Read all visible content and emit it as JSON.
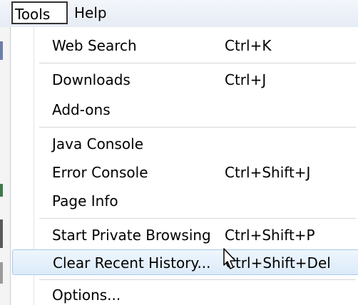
{
  "menubar": {
    "tools_label": "Tools",
    "help_label": "Help"
  },
  "menu": {
    "web_search": {
      "label": "Web Search",
      "shortcut": "Ctrl+K"
    },
    "downloads": {
      "label": "Downloads",
      "shortcut": "Ctrl+J"
    },
    "addons": {
      "label": "Add-ons"
    },
    "java_console": {
      "label": "Java Console"
    },
    "error_console": {
      "label": "Error Console",
      "shortcut": "Ctrl+Shift+J"
    },
    "page_info": {
      "label": "Page Info"
    },
    "private_browsing": {
      "label": "Start Private Browsing",
      "shortcut": "Ctrl+Shift+P"
    },
    "clear_history": {
      "label": "Clear Recent History...",
      "shortcut": "Ctrl+Shift+Del"
    },
    "options": {
      "label": "Options..."
    }
  },
  "colors": {
    "highlight_bg": "#dcebfa",
    "highlight_border": "#a9c9ea"
  },
  "icons": {
    "cursor": "mouse-pointer-icon"
  }
}
